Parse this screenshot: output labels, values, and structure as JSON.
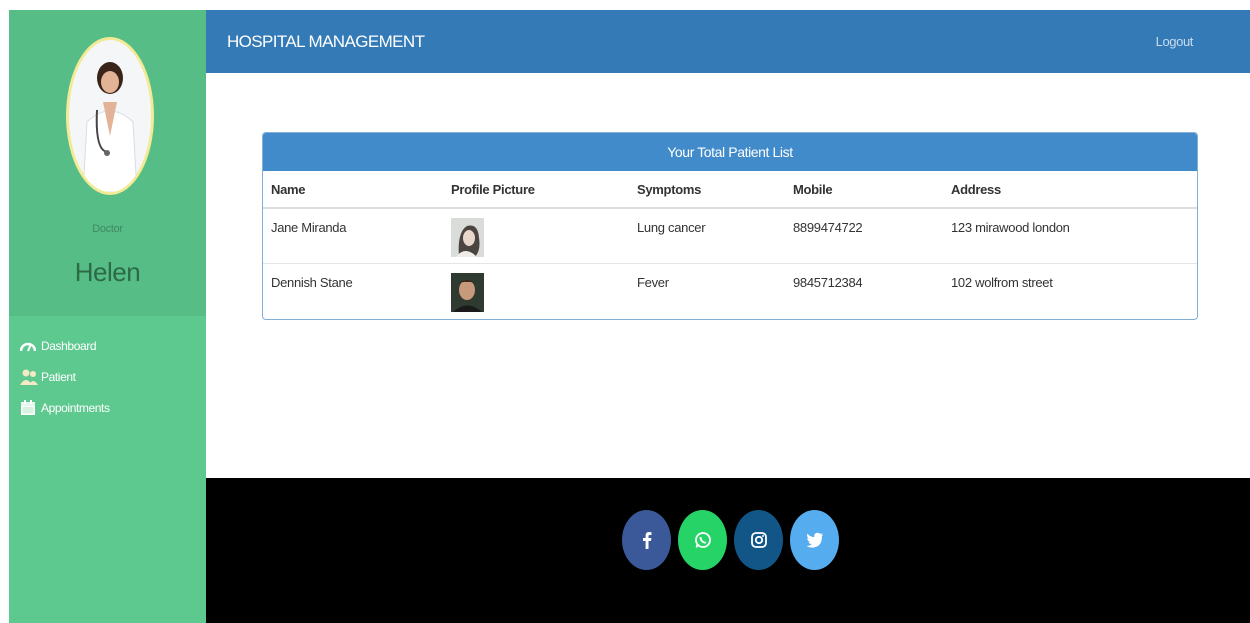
{
  "header": {
    "title": "HOSPITAL MANAGEMENT",
    "logout_label": "Logout"
  },
  "sidebar": {
    "role": "Doctor",
    "name": "Helen",
    "items": [
      {
        "label": "Dashboard",
        "icon": "dashboard-icon"
      },
      {
        "label": "Patient",
        "icon": "patient-icon"
      },
      {
        "label": "Appointments",
        "icon": "calendar-icon"
      }
    ]
  },
  "patients": {
    "title": "Your Total Patient List",
    "columns": [
      "Name",
      "Profile Picture",
      "Symptoms",
      "Mobile",
      "Address"
    ],
    "rows": [
      {
        "name": "Jane Miranda",
        "symptoms": "Lung cancer",
        "mobile": "8899474722",
        "address": "123 mirawood london"
      },
      {
        "name": "Dennish Stane",
        "symptoms": "Fever",
        "mobile": "9845712384",
        "address": "102 wolfrom street"
      }
    ]
  },
  "footer": {
    "social": [
      {
        "icon": "facebook-icon",
        "color": "#3b5998"
      },
      {
        "icon": "whatsapp-icon",
        "color": "#25d366"
      },
      {
        "icon": "instagram-icon",
        "color": "#125688"
      },
      {
        "icon": "twitter-icon",
        "color": "#55acee"
      }
    ]
  },
  "colors": {
    "sidebar": "#5ec98f",
    "header": "#337ab7",
    "panel_head": "#428bca",
    "footer": "#000000"
  }
}
